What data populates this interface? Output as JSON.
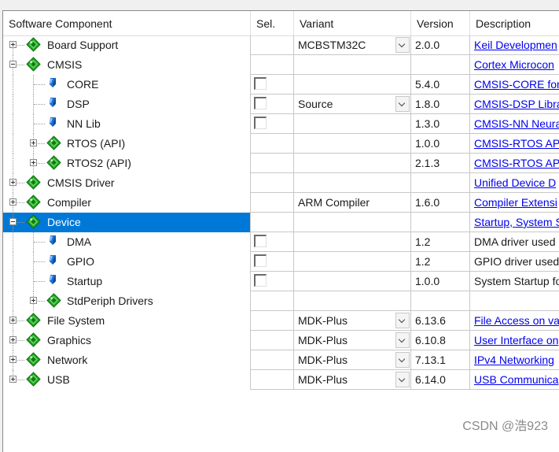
{
  "columns": {
    "component": "Software Component",
    "sel": "Sel.",
    "variant": "Variant",
    "version": "Version",
    "description": "Description"
  },
  "rows": [
    {
      "name": "Board Support",
      "level": 0,
      "expander": "plus",
      "icon": "green-gem-icon",
      "checkbox": false,
      "variant": "MCBSTM32C",
      "dropdown": true,
      "version": "2.0.0",
      "description": "Keil Developmen",
      "desc_link": true
    },
    {
      "name": "CMSIS",
      "level": 0,
      "expander": "minus",
      "icon": "green-gem-icon",
      "checkbox": false,
      "variant": "",
      "dropdown": false,
      "version": "",
      "description": "Cortex Microcon",
      "desc_link": true
    },
    {
      "name": "CORE",
      "level": 1,
      "expander": "none",
      "icon": "blue-gem-icon",
      "checkbox": true,
      "variant": "",
      "dropdown": false,
      "version": "5.4.0",
      "description": "CMSIS-CORE for",
      "desc_link": true
    },
    {
      "name": "DSP",
      "level": 1,
      "expander": "none",
      "icon": "blue-gem-icon",
      "checkbox": true,
      "variant": "Source",
      "dropdown": true,
      "version": "1.8.0",
      "description": "CMSIS-DSP Libra",
      "desc_link": true
    },
    {
      "name": "NN Lib",
      "level": 1,
      "expander": "none",
      "icon": "blue-gem-icon",
      "checkbox": true,
      "variant": "",
      "dropdown": false,
      "version": "1.3.0",
      "description": "CMSIS-NN Neura",
      "desc_link": true
    },
    {
      "name": "RTOS (API)",
      "level": 1,
      "expander": "plus",
      "icon": "green-gem-icon",
      "checkbox": false,
      "variant": "",
      "dropdown": false,
      "version": "1.0.0",
      "description": "CMSIS-RTOS API",
      "desc_link": true
    },
    {
      "name": "RTOS2 (API)",
      "level": 1,
      "expander": "plus",
      "icon": "green-gem-icon",
      "checkbox": false,
      "variant": "",
      "dropdown": false,
      "version": "2.1.3",
      "description": "CMSIS-RTOS API",
      "desc_link": true
    },
    {
      "name": "CMSIS Driver",
      "level": 0,
      "expander": "plus",
      "icon": "green-gem-icon",
      "checkbox": false,
      "variant": "",
      "dropdown": false,
      "version": "",
      "description": "Unified Device D",
      "desc_link": true
    },
    {
      "name": "Compiler",
      "level": 0,
      "expander": "plus",
      "icon": "green-gem-icon",
      "checkbox": false,
      "variant": "ARM Compiler",
      "dropdown": false,
      "version": "1.6.0",
      "description": "Compiler Extensi",
      "desc_link": true
    },
    {
      "name": "Device",
      "level": 0,
      "expander": "minus",
      "icon": "green-gem-icon",
      "checkbox": false,
      "variant": "",
      "dropdown": false,
      "version": "",
      "description": "Startup, System S",
      "desc_link": true,
      "selected": true
    },
    {
      "name": "DMA",
      "level": 1,
      "expander": "none",
      "icon": "blue-gem-icon",
      "checkbox": true,
      "variant": "",
      "dropdown": false,
      "version": "1.2",
      "description": "DMA driver used",
      "desc_link": false
    },
    {
      "name": "GPIO",
      "level": 1,
      "expander": "none",
      "icon": "blue-gem-icon",
      "checkbox": true,
      "variant": "",
      "dropdown": false,
      "version": "1.2",
      "description": "GPIO driver used",
      "desc_link": false
    },
    {
      "name": "Startup",
      "level": 1,
      "expander": "none",
      "icon": "blue-gem-icon",
      "checkbox": true,
      "variant": "",
      "dropdown": false,
      "version": "1.0.0",
      "description": "System Startup fo",
      "desc_link": false
    },
    {
      "name": "StdPeriph Drivers",
      "level": 1,
      "expander": "plus",
      "icon": "green-gem-icon",
      "checkbox": false,
      "variant": "",
      "dropdown": false,
      "version": "",
      "description": "",
      "desc_link": false
    },
    {
      "name": "File System",
      "level": 0,
      "expander": "plus",
      "icon": "green-gem-icon",
      "checkbox": false,
      "variant": "MDK-Plus",
      "dropdown": true,
      "version": "6.13.6",
      "description": "File Access on va",
      "desc_link": true
    },
    {
      "name": "Graphics",
      "level": 0,
      "expander": "plus",
      "icon": "green-gem-icon",
      "checkbox": false,
      "variant": "MDK-Plus",
      "dropdown": true,
      "version": "6.10.8",
      "description": "User Interface on",
      "desc_link": true
    },
    {
      "name": "Network",
      "level": 0,
      "expander": "plus",
      "icon": "green-gem-icon",
      "checkbox": false,
      "variant": "MDK-Plus",
      "dropdown": true,
      "version": "7.13.1",
      "description": "IPv4 Networking",
      "desc_link": true
    },
    {
      "name": "USB",
      "level": 0,
      "expander": "plus",
      "icon": "green-gem-icon",
      "checkbox": false,
      "variant": "MDK-Plus",
      "dropdown": true,
      "version": "6.14.0",
      "description": "USB Communica",
      "desc_link": true
    }
  ],
  "watermark": "CSDN @浩923",
  "colors": {
    "selection": "#0078d7",
    "link": "#0000ee",
    "gem_green": "#1ea01e",
    "gem_blue": "#1c6fd0"
  }
}
